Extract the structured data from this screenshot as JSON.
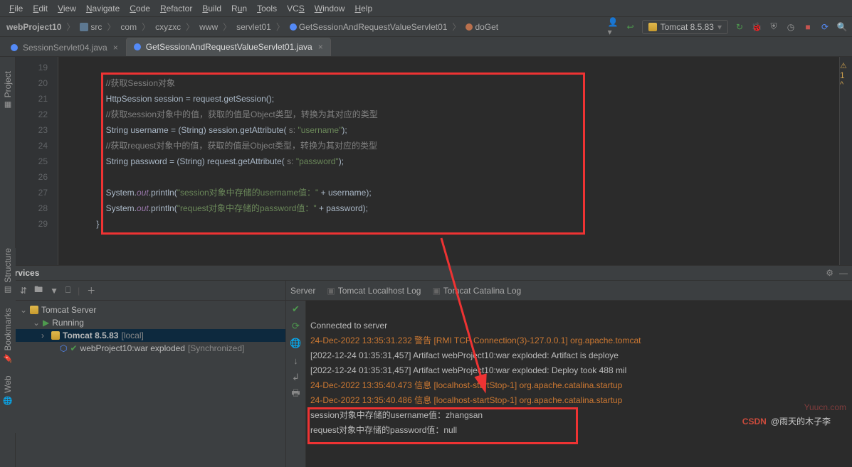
{
  "menu": {
    "file": "File",
    "edit": "Edit",
    "view": "View",
    "navigate": "Navigate",
    "code": "Code",
    "refactor": "Refactor",
    "build": "Build",
    "run": "Run",
    "tools": "Tools",
    "vcs": "VCS",
    "window": "Window",
    "help": "Help"
  },
  "breadcrumb": {
    "project": "webProject10",
    "src": "src",
    "com": "com",
    "cxyzxc": "cxyzxc",
    "www": "www",
    "servlet01": "servlet01",
    "class": "GetSessionAndRequestValueServlet01",
    "method": "doGet"
  },
  "run_config": {
    "name": "Tomcat 8.5.83"
  },
  "tabs": {
    "t1": "SessionServlet04.java",
    "t2": "GetSessionAndRequestValueServlet01.java"
  },
  "gutter": {
    "lines": [
      "19",
      "20",
      "21",
      "22",
      "23",
      "24",
      "25",
      "26",
      "27",
      "28",
      "29"
    ]
  },
  "code": {
    "l20c": "//获取Session对象",
    "l21a": "HttpSession session = request.getSession();",
    "l22c": "//获取session对象中的值，获取的值是Object类型，转换为其对应的类型",
    "l23a": "String username = (String) session.getAttribute(",
    "l23p": " s: ",
    "l23s": "\"username\"",
    "l23e": ");",
    "l24c": "//获取request对象中的值，获取的值是Object类型，转换为其对应的类型",
    "l25a": "String password = (String) request.getAttribute(",
    "l25p": " s: ",
    "l25s": "\"password\"",
    "l25e": ");",
    "l27a": "System.",
    "l27f": "out",
    "l27b": ".println(",
    "l27s": "\"session对象中存储的username值：\"",
    "l27c": " + username);",
    "l28a": "System.",
    "l28f": "out",
    "l28b": ".println(",
    "l28s": "\"request对象中存储的password值：\"",
    "l28c": " + password);",
    "l29": "    }"
  },
  "warn_count": "1",
  "services": {
    "title": "Services"
  },
  "svc_tabs": {
    "server": "Server",
    "log1": "Tomcat Localhost Log",
    "log2": "Tomcat Catalina Log"
  },
  "tree": {
    "root": "Tomcat Server",
    "running": "Running",
    "config": "Tomcat 8.5.83",
    "config_suffix": "[local]",
    "artifact": "webProject10:war exploded",
    "artifact_suffix": "[Synchronized]"
  },
  "console": {
    "l1": "Connected to server",
    "l2": "24-Dec-2022 13:35:31.232 警告 [RMI TCP Connection(3)-127.0.0.1] org.apache.tomcat",
    "l3": "[2022-12-24 01:35:31,457] Artifact webProject10:war exploded: Artifact is deploye",
    "l4": "[2022-12-24 01:35:31,457] Artifact webProject10:war exploded: Deploy took 488 mil",
    "l5": "24-Dec-2022 13:35:40.473 信息 [localhost-startStop-1] org.apache.catalina.startup",
    "l6": "24-Dec-2022 13:35:40.486 信息 [localhost-startStop-1] org.apache.catalina.startup",
    "l7": "session对象中存储的username值：zhangsan",
    "l8": "request对象中存储的password值：null"
  },
  "sidebar": {
    "project": "Project",
    "structure": "Structure",
    "bookmarks": "Bookmarks",
    "web": "Web"
  },
  "watermark": "Yuucn.com",
  "csdn": {
    "logo": "CSDN",
    "author": "@雨天的木子李"
  }
}
